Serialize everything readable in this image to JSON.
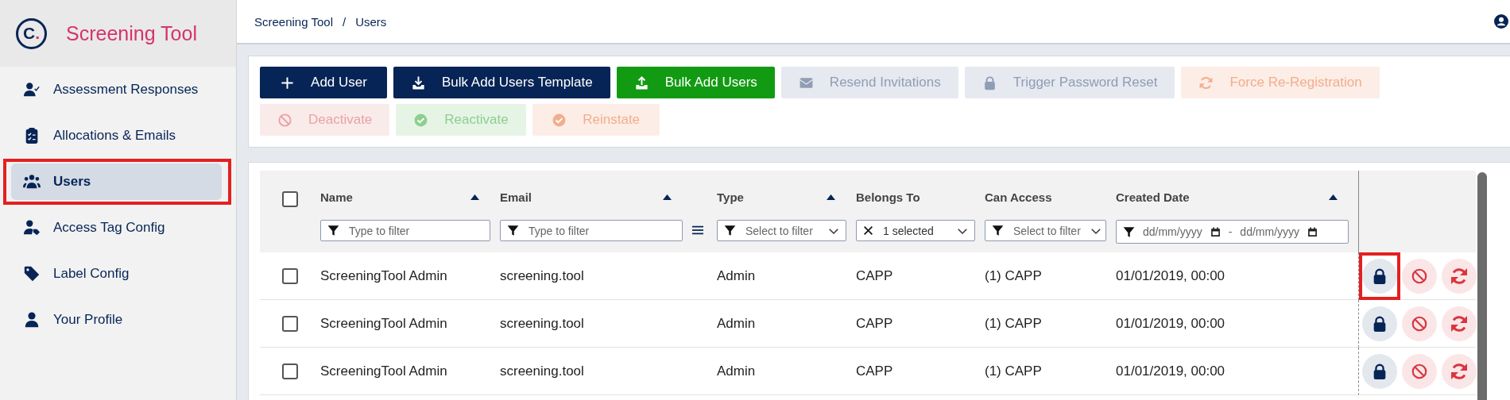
{
  "sidebar": {
    "logo": {
      "letter": "C",
      "dot": "."
    },
    "title": "Screening Tool",
    "items": [
      {
        "label": "Assessment Responses",
        "kind": "user-check",
        "selected": false,
        "highlighted": false
      },
      {
        "label": "Allocations & Emails",
        "kind": "clipboard",
        "selected": false,
        "highlighted": false
      },
      {
        "label": "Users",
        "kind": "users",
        "selected": true,
        "highlighted": true
      },
      {
        "label": "Access Tag Config",
        "kind": "user-tag",
        "selected": false,
        "highlighted": false
      },
      {
        "label": "Label Config",
        "kind": "tag",
        "selected": false,
        "highlighted": false
      },
      {
        "label": "Your Profile",
        "kind": "user",
        "selected": false,
        "highlighted": false
      }
    ]
  },
  "breadcrumb": {
    "items": [
      "Screening Tool",
      "Users"
    ],
    "separator": "/"
  },
  "toolbar": {
    "buttons": [
      {
        "label": "Add User",
        "kind": "add",
        "color": "#062456",
        "disabled": false
      },
      {
        "label": "Bulk Add Users Template",
        "kind": "download",
        "color": "#062456",
        "disabled": false
      },
      {
        "label": "Bulk Add Users",
        "kind": "upload",
        "color": "#129b12",
        "disabled": false
      },
      {
        "label": "Resend Invitations",
        "kind": "resend",
        "color": "#8f9db5",
        "disabled": true
      },
      {
        "label": "Trigger Password Reset",
        "kind": "reset",
        "color": "#8f9db5",
        "disabled": true
      },
      {
        "label": "Force Re-Registration",
        "kind": "reregister",
        "color": "#f2ae8e",
        "disabled": true
      },
      {
        "label": "Deactivate",
        "kind": "deactivate",
        "color": "#eaa2a6",
        "disabled": true
      },
      {
        "label": "Reactivate",
        "kind": "reactivate",
        "color": "#8ecf8e",
        "disabled": true
      },
      {
        "label": "Reinstate",
        "kind": "reinstate",
        "color": "#f2ae8e",
        "disabled": true
      }
    ]
  },
  "table": {
    "select_all": {
      "checked": false
    },
    "columns": [
      {
        "label": "Name",
        "sortable": true,
        "filter": {
          "kind": "text",
          "placeholder": "Type to filter"
        }
      },
      {
        "label": "Email",
        "sortable": true,
        "filter": {
          "kind": "text",
          "placeholder": "Type to filter"
        }
      },
      {
        "label": "Type",
        "sortable": true,
        "filter": {
          "kind": "select",
          "placeholder": "Select to filter"
        }
      },
      {
        "label": "Belongs To",
        "sortable": false,
        "filter": {
          "kind": "multi",
          "value": "1 selected"
        }
      },
      {
        "label": "Can Access",
        "sortable": false,
        "filter": {
          "kind": "select",
          "placeholder": "Select to filter"
        }
      },
      {
        "label": "Created Date",
        "sortable": true,
        "filter": {
          "kind": "daterange",
          "from": "dd/mm/yyyy",
          "separator": "-",
          "to": "dd/mm/yyyy"
        }
      }
    ],
    "rows": [
      {
        "checked": false,
        "cells": [
          "ScreeningTool Admin",
          "screening.tool",
          "Admin",
          "CAPP",
          "(1) CAPP",
          "01/01/2019, 00:00"
        ],
        "actions": [
          {
            "kind": "reset",
            "highlighted": true
          },
          {
            "kind": "deactivate",
            "highlighted": false
          },
          {
            "kind": "reregister",
            "highlighted": false
          }
        ]
      },
      {
        "checked": false,
        "cells": [
          "ScreeningTool Admin",
          "screening.tool",
          "Admin",
          "CAPP",
          "(1) CAPP",
          "01/01/2019, 00:00"
        ],
        "actions": [
          {
            "kind": "reset",
            "highlighted": false
          },
          {
            "kind": "deactivate",
            "highlighted": false
          },
          {
            "kind": "reregister",
            "highlighted": false
          }
        ]
      },
      {
        "checked": false,
        "cells": [
          "ScreeningTool Admin",
          "screening.tool",
          "Admin",
          "CAPP",
          "(1) CAPP",
          "01/01/2019, 00:00"
        ],
        "actions": [
          {
            "kind": "reset",
            "highlighted": false
          },
          {
            "kind": "deactivate",
            "highlighted": false
          },
          {
            "kind": "reregister",
            "highlighted": false
          }
        ]
      }
    ]
  }
}
